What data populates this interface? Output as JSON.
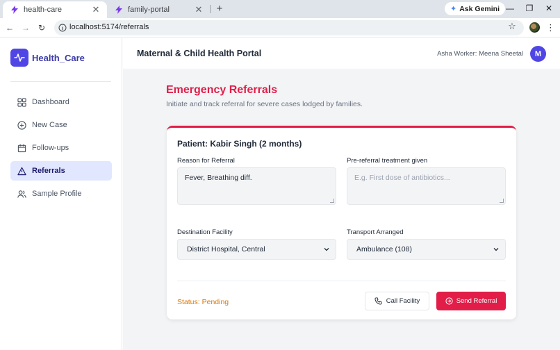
{
  "browser": {
    "tabs": [
      {
        "title": "health-care",
        "active": true
      },
      {
        "title": "family-portal",
        "active": false
      }
    ],
    "gemini_label": "Ask Gemini",
    "url": "localhost:5174/referrals"
  },
  "sidebar": {
    "brand": "Health_Care",
    "items": [
      {
        "label": "Dashboard",
        "icon": "grid-icon",
        "active": false
      },
      {
        "label": "New Case",
        "icon": "plus-circle-icon",
        "active": false
      },
      {
        "label": "Follow-ups",
        "icon": "calendar-icon",
        "active": false
      },
      {
        "label": "Referrals",
        "icon": "alert-triangle-icon",
        "active": true
      },
      {
        "label": "Sample Profile",
        "icon": "users-icon",
        "active": false
      }
    ]
  },
  "header": {
    "title": "Maternal & Child Health Portal",
    "user": "Asha Worker: Meena Sheetal",
    "avatar_initial": "M"
  },
  "page": {
    "title": "Emergency Referrals",
    "subtitle": "Initiate and track referral for severe cases lodged by families."
  },
  "referral": {
    "patient": "Patient: Kabir Singh (2 months)",
    "reason_label": "Reason for Referral",
    "reason_value": "Fever, Breathing diff.",
    "treatment_label": "Pre-referral treatment given",
    "treatment_placeholder": "E.g. First dose of antibiotics...",
    "destination_label": "Destination Facility",
    "destination_value": "District Hospital, Central",
    "transport_label": "Transport Arranged",
    "transport_value": "Ambulance (108)",
    "status": "Status: Pending",
    "call_button": "Call Facility",
    "send_button": "Send Referral"
  },
  "colors": {
    "accent": "#e11d48",
    "brand": "#4f46e5",
    "status_pending": "#d97706",
    "nav_active_bg": "#e0e7ff"
  }
}
